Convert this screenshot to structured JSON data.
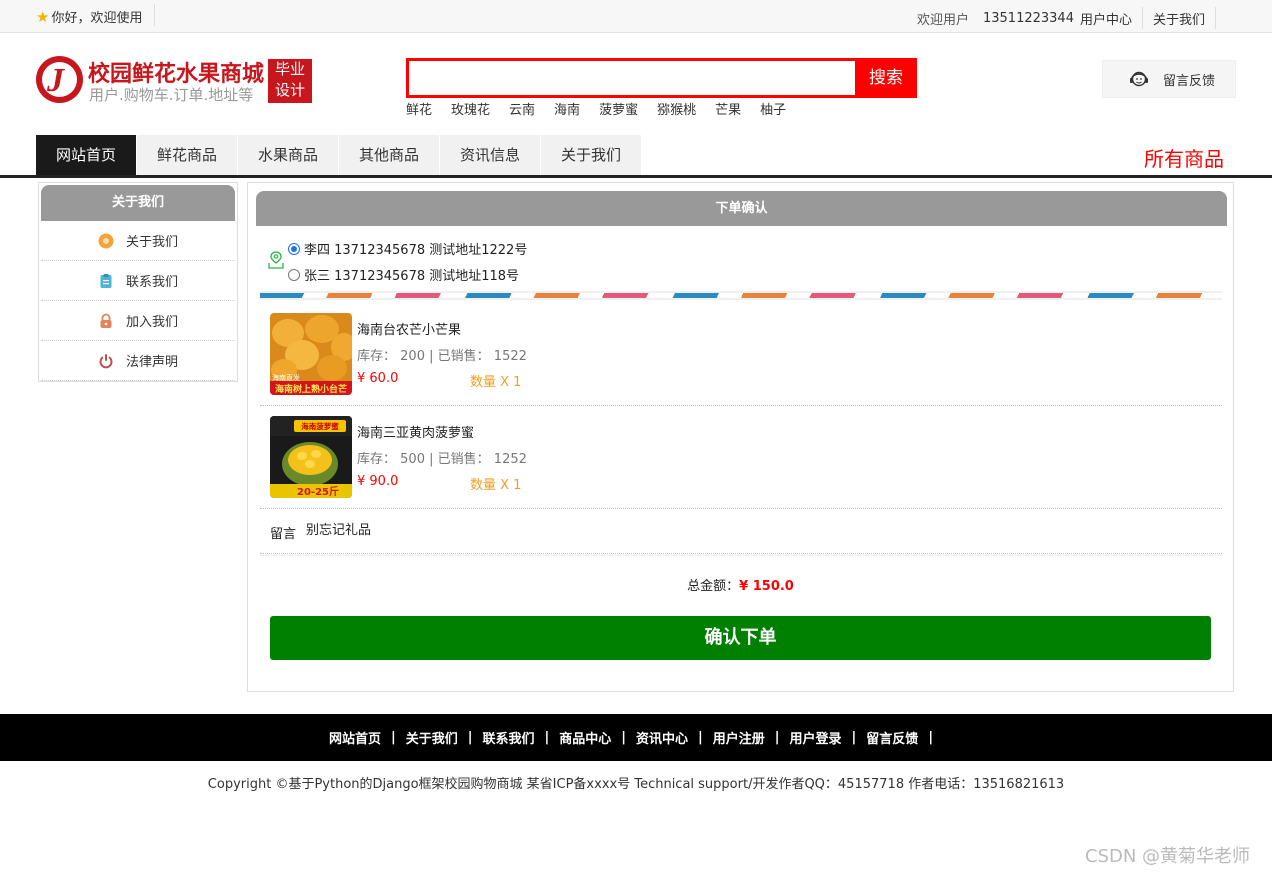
{
  "topbar": {
    "greeting": "你好，欢迎使用",
    "welcome_user": "欢迎用户",
    "phone": "13511223344",
    "user_center": "用户中心",
    "about": "关于我们"
  },
  "header": {
    "logo_letter": "J",
    "site_title": "校园鲜花水果商城",
    "site_subtitle": "用户.购物车.订单.地址等",
    "badge_line1": "毕业",
    "badge_line2": "设计",
    "search_value": "",
    "search_button": "搜索",
    "hot_words": [
      "鲜花",
      "玫瑰花",
      "云南",
      "海南",
      "菠萝蜜",
      "猕猴桃",
      "芒果",
      "柚子"
    ],
    "feedback": "留言反馈"
  },
  "nav": {
    "items": [
      "网站首页",
      "鲜花商品",
      "水果商品",
      "其他商品",
      "资讯信息",
      "关于我们"
    ],
    "active_index": 0,
    "all_goods": "所有商品"
  },
  "sidebar": {
    "title": "关于我们",
    "items": [
      {
        "label": "关于我们",
        "icon": "info-circle-icon",
        "color": "#f3a33b"
      },
      {
        "label": "联系我们",
        "icon": "clipboard-icon",
        "color": "#4fb3d9"
      },
      {
        "label": "加入我们",
        "icon": "lock-icon",
        "color": "#e0855a"
      },
      {
        "label": "法律声明",
        "icon": "power-icon",
        "color": "#c0504d"
      }
    ]
  },
  "order": {
    "title": "下单确认",
    "addresses": [
      {
        "text": "李四 13712345678 测试地址1222号",
        "selected": true
      },
      {
        "text": "张三 13712345678 测试地址118号",
        "selected": false
      }
    ],
    "products": [
      {
        "name": "海南台农芒小芒果",
        "stock_label": "库存：",
        "stock": "200",
        "sold_label": "已销售：",
        "sold": "1522",
        "price": "¥ 60.0",
        "qty": "数量 X 1",
        "img_caption": "海南树上熟小台芒",
        "img_tag": "海南直发"
      },
      {
        "name": "海南三亚黄肉菠萝蜜",
        "stock_label": "库存：",
        "stock": "500",
        "sold_label": "已销售：",
        "sold": "1252",
        "price": "¥ 90.0",
        "qty": "数量 X 1",
        "img_caption": "20-25斤",
        "img_tag": "海南菠萝蜜"
      }
    ],
    "message_label": "留言",
    "message_value": "别忘记礼品",
    "total_label": "总金额：",
    "total_value": "¥ 150.0",
    "confirm_button": "确认下单"
  },
  "footer": {
    "links": [
      "网站首页",
      "关于我们",
      "联系我们",
      "商品中心",
      "资讯中心",
      "用户注册",
      "用户登录",
      "留言反馈"
    ],
    "copyright": "Copyright ©基于Python的Django框架校园购物商城 某省ICP备xxxx号    Technical support/开发作者QQ：45157718     作者电话：13516821613"
  },
  "watermark": "CSDN @黄菊华老师",
  "colors": {
    "brand_red": "#c8161d",
    "search_red": "#ff0000",
    "confirm_green": "#008000",
    "qty_orange": "#f0a020"
  }
}
